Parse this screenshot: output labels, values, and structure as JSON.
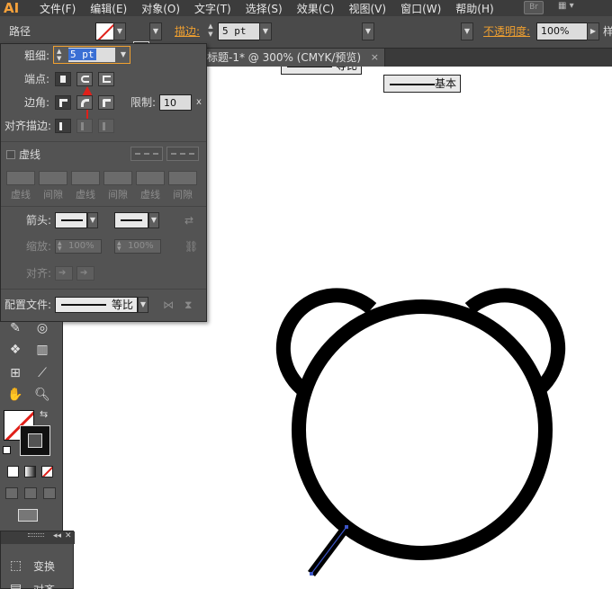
{
  "app": {
    "logo": "AI",
    "br_badge": "Br"
  },
  "menu": [
    "文件(F)",
    "编辑(E)",
    "对象(O)",
    "文字(T)",
    "选择(S)",
    "效果(C)",
    "视图(V)",
    "窗口(W)",
    "帮助(H)"
  ],
  "control_bar": {
    "object_type": "路径",
    "stroke_link": "描边:",
    "stroke_weight": "5 pt",
    "profile_label": "等比",
    "brush_label": "基本",
    "opacity_link": "不透明度:",
    "opacity_value": "100%",
    "style_label": "样"
  },
  "document_tab": {
    "title": "标题-1* @ 300% (CMYK/预览)",
    "close": "×"
  },
  "stroke_panel": {
    "weight_label": "粗细:",
    "weight_value": "5 pt",
    "cap_label": "端点:",
    "corner_label": "边角:",
    "limit_label": "限制:",
    "limit_value": "10",
    "limit_suffix": "x",
    "align_label": "对齐描边:",
    "dashed_label": "虚线",
    "dash_fields": [
      "虚线",
      "间隙",
      "虚线",
      "间隙",
      "虚线",
      "间隙"
    ],
    "arrow_label": "箭头:",
    "scale_label": "缩放:",
    "scale_start": "100%",
    "scale_end": "100%",
    "align_arrow_label": "对齐:",
    "profile_label": "配置文件:",
    "profile_value": "等比"
  },
  "bottom_panel": {
    "label": "变换",
    "label2": "对齐"
  },
  "icons": [
    "pen-nib-icon",
    "arrow-annotation-icon",
    "eyedropper-icon",
    "blend-icon",
    "symbol-sprayer-icon",
    "column-graph-icon",
    "artboard-icon",
    "slice-icon",
    "hand-icon",
    "zoom-icon",
    "swap-fill-stroke-icon",
    "default-fill-stroke-icon",
    "screen-mode-icon"
  ],
  "colors": {
    "accent_orange": "#f0a030",
    "annotation_red": "#e0201a",
    "selection_blue": "#3c55c8"
  }
}
